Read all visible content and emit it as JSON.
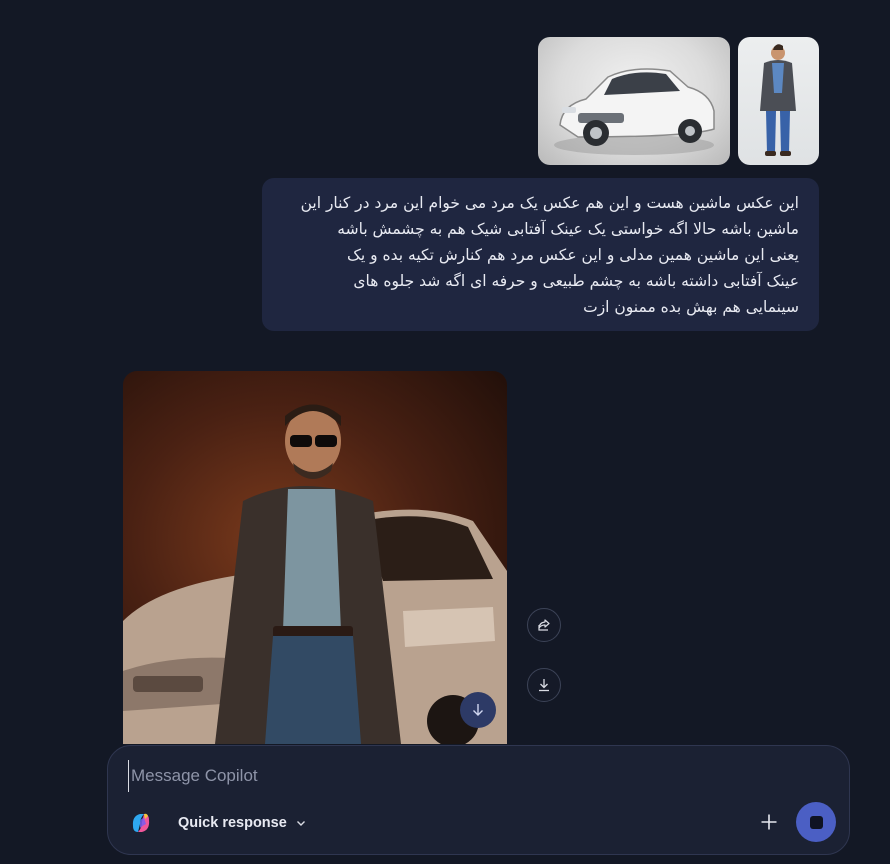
{
  "user_message": {
    "attachments": [
      {
        "icon": "car-photo"
      },
      {
        "icon": "man-photo"
      }
    ],
    "lines": [
      "این عکس ماشین هست و این هم عکس یک مرد می خوام این مرد در کنار این",
      "ماشین باشه حالا اگه خواستی یک عینک آفتابی شیک هم به چشمش باشه",
      "یعنی این ماشین همین مدلی و این عکس مرد هم کنارش تکیه بده و یک",
      "عینک آفتابی داشته باشه به چشم طبیعی و حرفه ای اگه شد جلوه های",
      "سینمایی هم بهش بده ممنون ازت"
    ]
  },
  "response": {
    "image_icon": "man-with-car-image",
    "actions": {
      "share_icon": "share-icon",
      "download_icon": "download-icon"
    },
    "scroll_down_icon": "arrow-down-icon"
  },
  "composer": {
    "placeholder": "Message Copilot",
    "mode_label": "Quick response",
    "colors": {
      "accent": "#4b5fc4",
      "background": "#131825",
      "bubble": "#1f2640"
    }
  }
}
